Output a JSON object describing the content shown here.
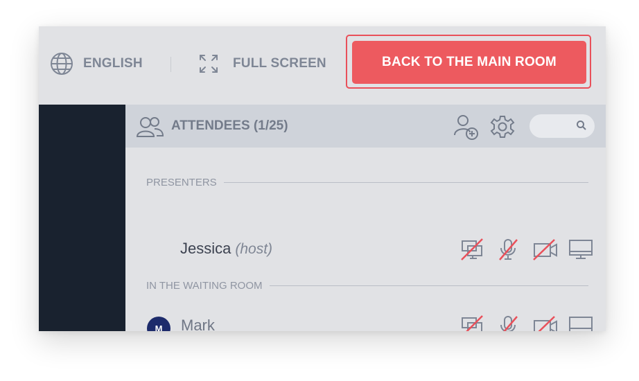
{
  "topbar": {
    "language_label": "ENGLISH",
    "fullscreen_label": "FULL SCREEN",
    "back_button_label": "BACK TO THE MAIN ROOM"
  },
  "panel": {
    "title": "ATTENDEES (1/25)",
    "search_placeholder": ""
  },
  "sections": [
    {
      "title": "PRESENTERS",
      "attendees": [
        {
          "name": "Jessica",
          "role": "(host)",
          "avatar": ""
        }
      ]
    },
    {
      "title": "IN THE WAITING ROOM",
      "attendees": [
        {
          "name": "Mark",
          "role": "",
          "avatar": "M"
        }
      ]
    }
  ],
  "icons": {
    "language": "globe-icon",
    "fullscreen": "expand-icon",
    "attendees": "attendees-icon",
    "add_person": "add-person-icon",
    "settings": "gear-icon",
    "search": "search-icon",
    "row_controls": [
      "presenter-off-icon",
      "mic-off-icon",
      "camera-off-icon",
      "screen-icon"
    ]
  },
  "colors": {
    "accent_red": "#ed5a5f",
    "sidebar_dark": "#19222f",
    "avatar_navy": "#1d2b6b",
    "strike_red": "#e9505a"
  }
}
